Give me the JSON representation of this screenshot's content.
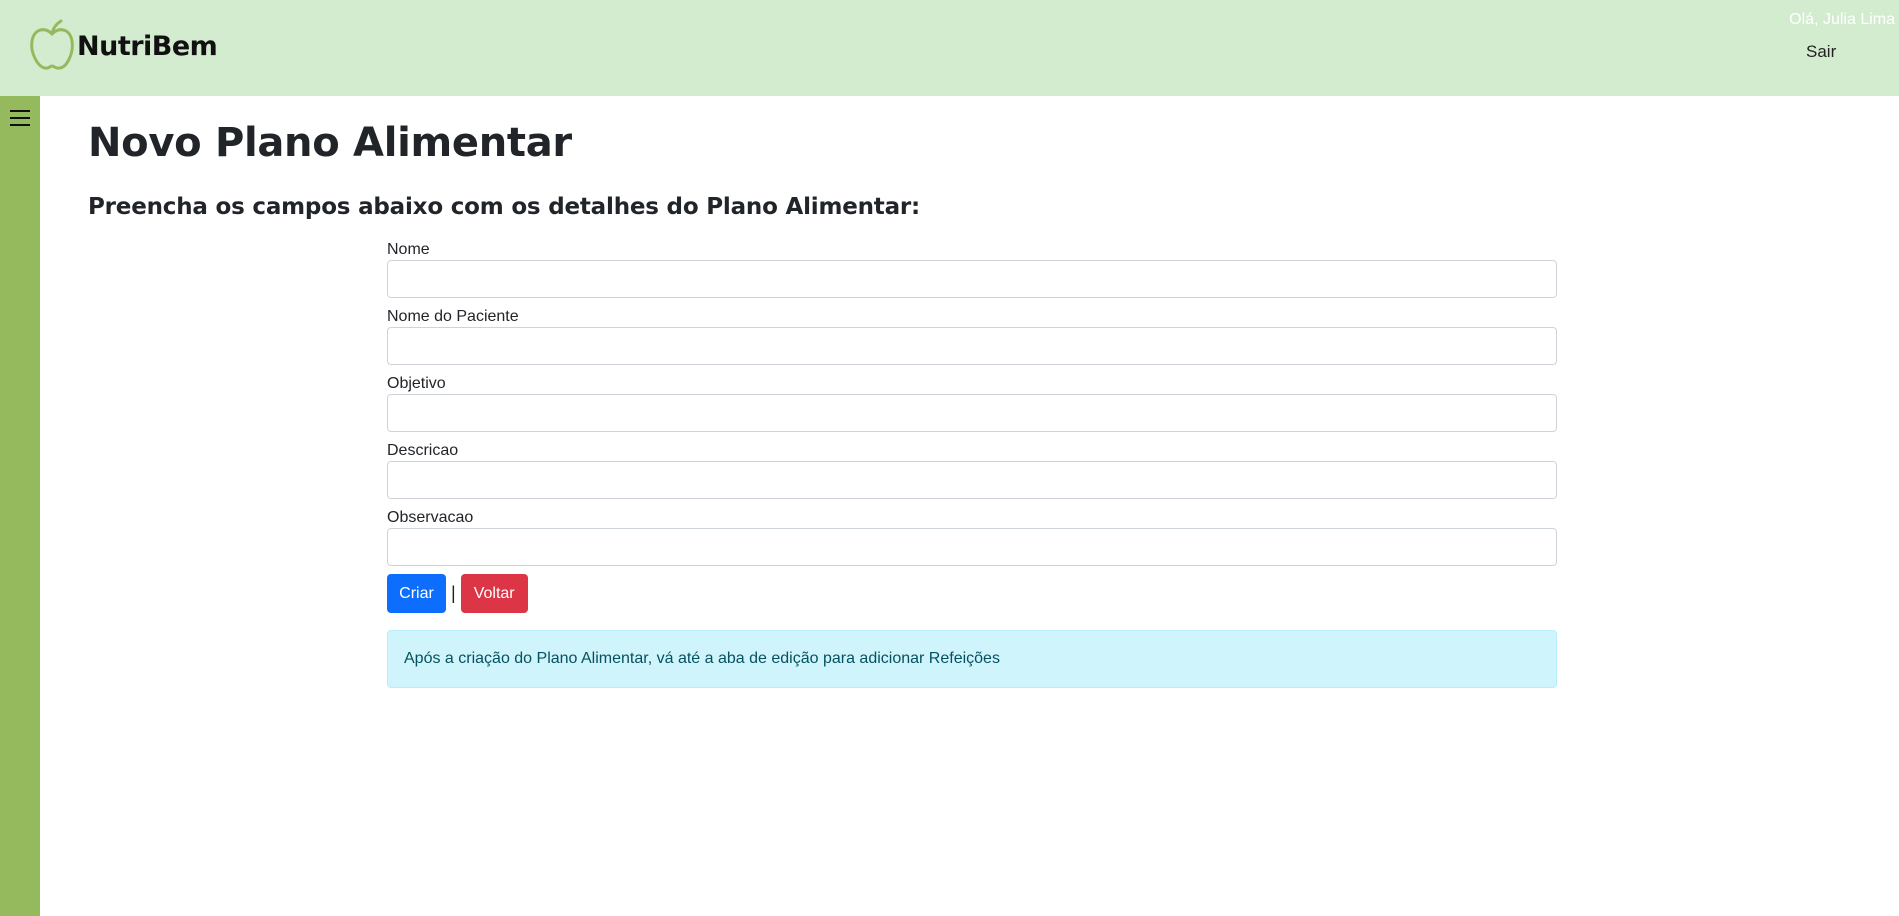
{
  "brand": {
    "name": "NutriBem",
    "logo_icon": "apple-icon"
  },
  "header": {
    "greeting": "Olá, Julia Lima",
    "logout_label": "Sair"
  },
  "sidebar": {
    "toggle_icon": "hamburger-menu-icon"
  },
  "page": {
    "title": "Novo Plano Alimentar",
    "subtitle": "Preencha os campos abaixo com os detalhes do Plano Alimentar:"
  },
  "form": {
    "fields": [
      {
        "label": "Nome",
        "value": "",
        "placeholder": ""
      },
      {
        "label": "Nome do Paciente",
        "value": "",
        "placeholder": ""
      },
      {
        "label": "Objetivo",
        "value": "",
        "placeholder": ""
      },
      {
        "label": "Descricao",
        "value": "",
        "placeholder": ""
      },
      {
        "label": "Observacao",
        "value": "",
        "placeholder": ""
      }
    ],
    "create_label": "Criar",
    "separator": "|",
    "back_label": "Voltar"
  },
  "info_alert": "Após a criação do Plano Alimentar, vá até a aba de edição para adicionar Refeições",
  "colors": {
    "topbar": "#d3ecd0",
    "sidebar": "#95ba5e",
    "primary": "#0d6efd",
    "danger": "#dc3545",
    "alert_bg": "#cff4fc",
    "alert_text": "#055160"
  }
}
